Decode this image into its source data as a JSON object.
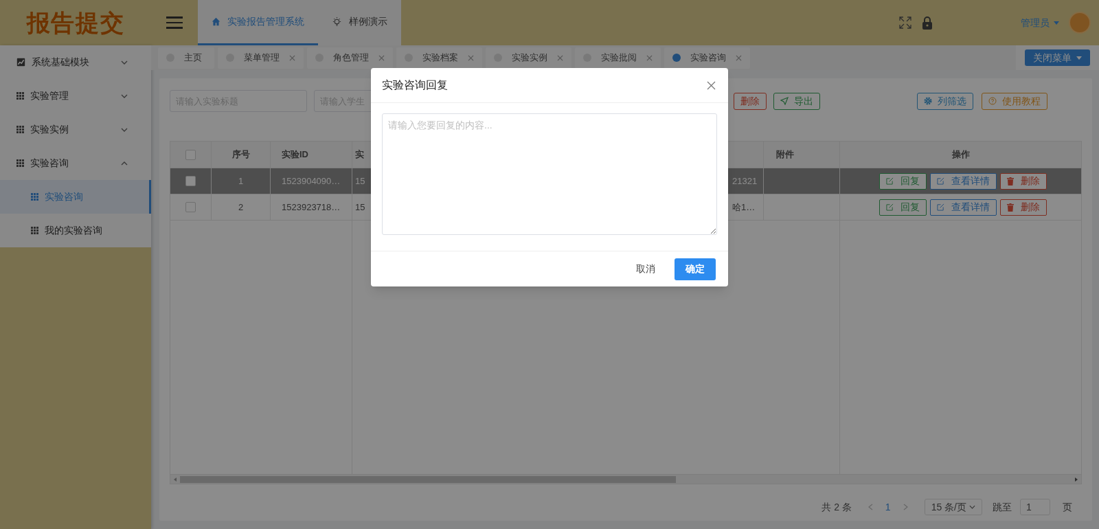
{
  "logo": "报告提交",
  "header": {
    "tabs": [
      {
        "label": "实验报告管理系统",
        "selected": true
      },
      {
        "label": "样例演示",
        "selected": false
      }
    ],
    "user": "管理员"
  },
  "sidebar": [
    {
      "label": "系统基础模块",
      "expanded": false
    },
    {
      "label": "实验管理",
      "expanded": false
    },
    {
      "label": "实验实例",
      "expanded": false
    },
    {
      "label": "实验咨询",
      "expanded": true,
      "children": [
        {
          "label": "实验咨询",
          "selected": true
        },
        {
          "label": "我的实验咨询",
          "selected": false
        }
      ]
    }
  ],
  "page_tabs": [
    {
      "label": "主页",
      "closable": false,
      "selected": false
    },
    {
      "label": "菜单管理",
      "closable": true,
      "selected": false
    },
    {
      "label": "角色管理",
      "closable": true,
      "selected": false
    },
    {
      "label": "实验档案",
      "closable": true,
      "selected": false
    },
    {
      "label": "实验实例",
      "closable": true,
      "selected": false
    },
    {
      "label": "实验批阅",
      "closable": true,
      "selected": false
    },
    {
      "label": "实验咨询",
      "closable": true,
      "selected": true
    }
  ],
  "close_menu": "关闭菜单",
  "filters": [
    {
      "placeholder": "请输入实验标题"
    },
    {
      "placeholder": "请输入学生"
    }
  ],
  "toolbar_left": [
    {
      "label": "删除",
      "kind": "delete"
    },
    {
      "label": "导出",
      "kind": "export"
    }
  ],
  "toolbar_right": [
    {
      "label": "列筛选",
      "kind": "columns"
    },
    {
      "label": "使用教程",
      "kind": "help"
    }
  ],
  "table": {
    "header_checked": false,
    "columns": [
      "序号",
      "实验ID",
      "实",
      "附件",
      "操作"
    ],
    "rows": [
      {
        "checked": false,
        "highlighted": true,
        "index": "1",
        "id": "1523904090…",
        "column_4": "15",
        "column_5": "21321",
        "actions": [
          {
            "label": "回复",
            "kind": "reply"
          },
          {
            "label": "查看详情",
            "kind": "view"
          },
          {
            "label": "删除",
            "kind": "delete"
          }
        ]
      },
      {
        "checked": false,
        "highlighted": false,
        "index": "2",
        "id": "1523923718…",
        "column_4": "15",
        "column_5": "哈1…",
        "actions": [
          {
            "label": "回复",
            "kind": "reply"
          },
          {
            "label": "查看详情",
            "kind": "view"
          },
          {
            "label": "删除",
            "kind": "delete"
          }
        ]
      }
    ]
  },
  "pagination": {
    "total": "共 2 条",
    "current": "1",
    "page_size": "15 条/页",
    "jump_label": "跳至",
    "jump_value": "1",
    "page_suffix": "页"
  },
  "modal": {
    "title": "实验咨询回复",
    "placeholder": "请输入您要回复的内容...",
    "buttons": [
      {
        "label": "取消",
        "kind": "default"
      },
      {
        "label": "确定",
        "kind": "primary"
      }
    ]
  }
}
